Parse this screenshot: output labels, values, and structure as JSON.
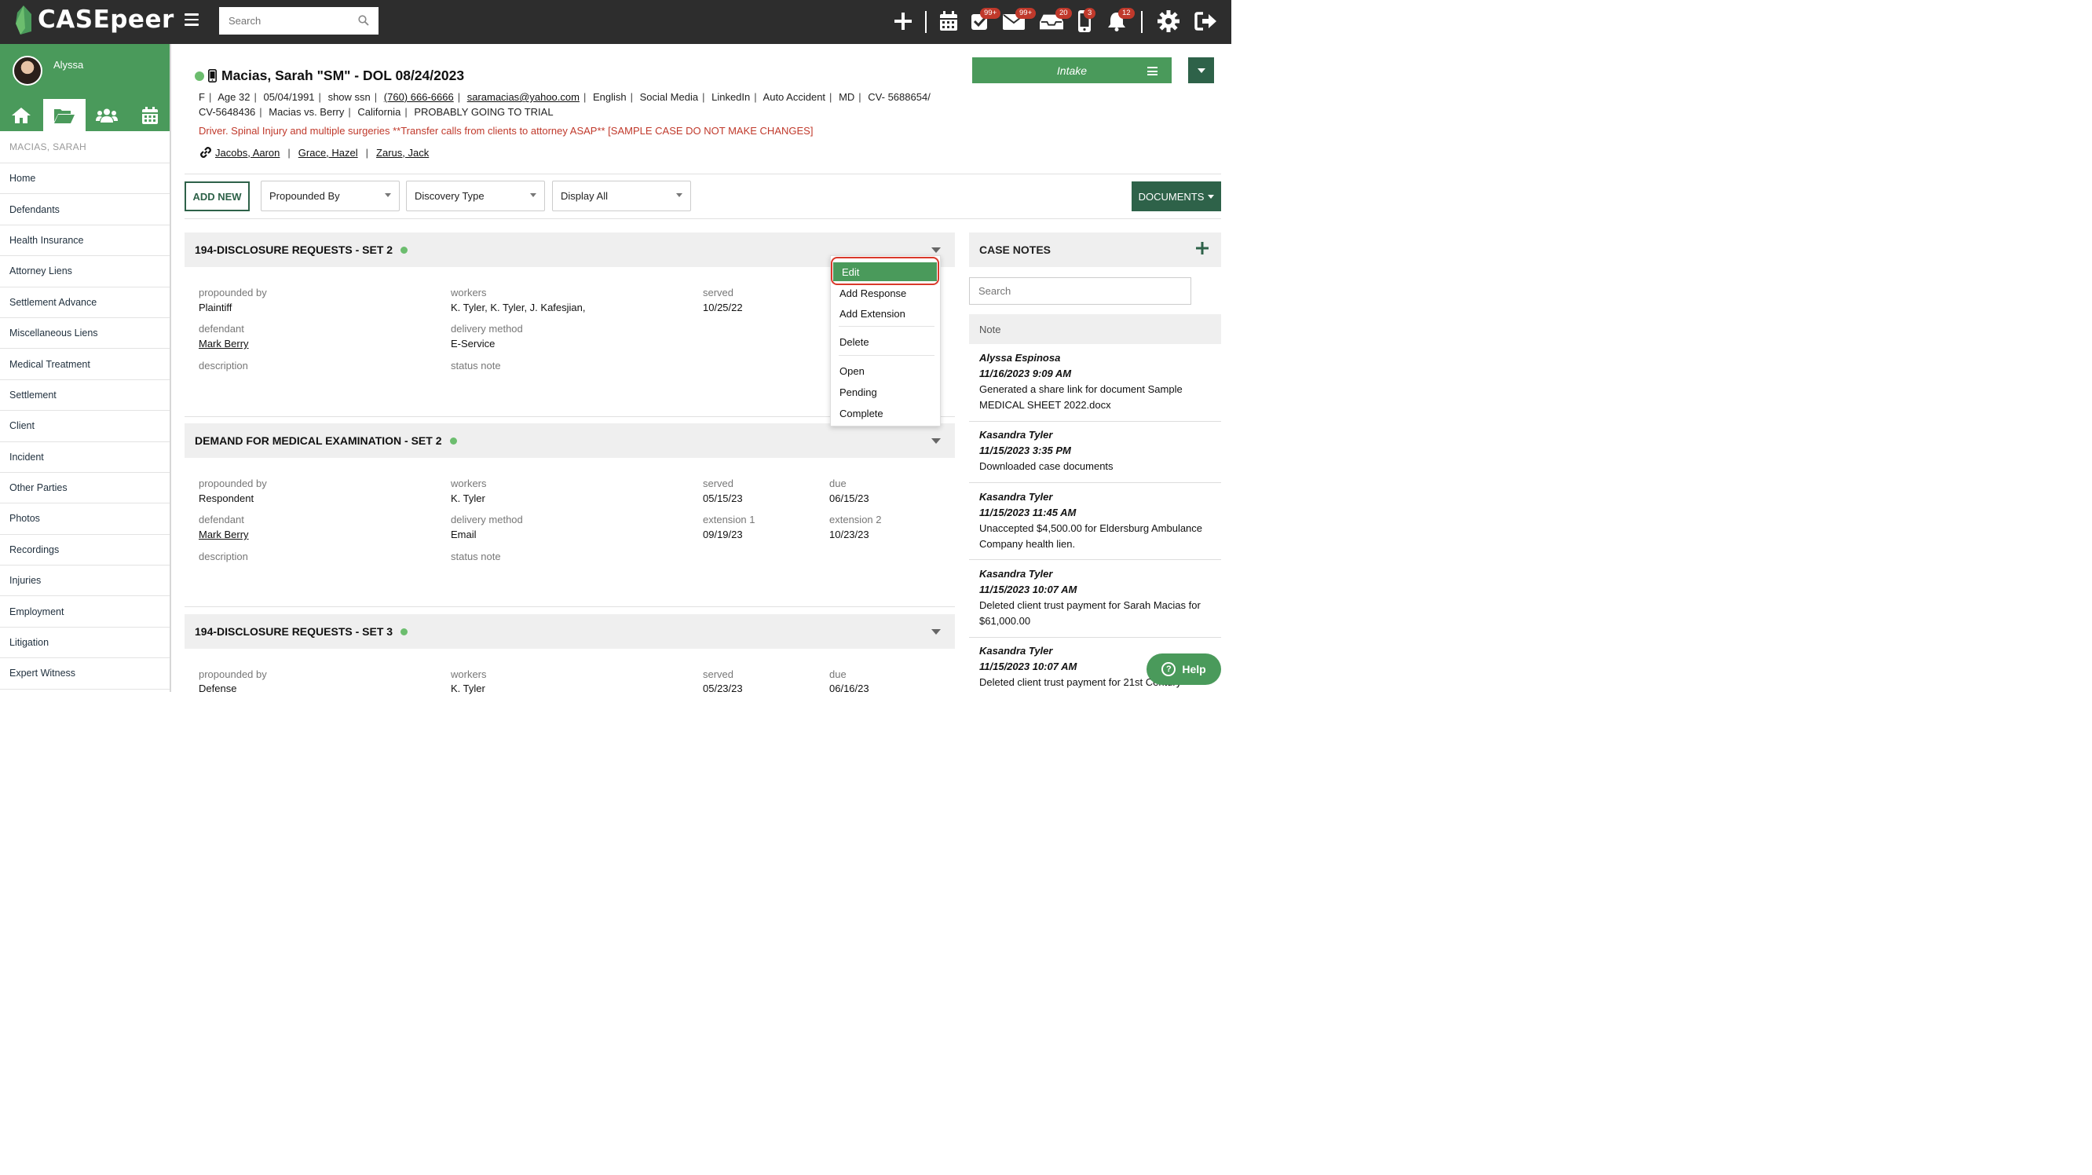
{
  "brand": {
    "name": "CASEpeer"
  },
  "topbar": {
    "search_placeholder": "Search",
    "badges": {
      "tasks": "99+",
      "mail": "99+",
      "inbox": "20",
      "phone": "3",
      "bell": "12"
    }
  },
  "sidebar": {
    "username": "Alyssa",
    "caption": "MACIAS, SARAH",
    "items": [
      "Home",
      "Defendants",
      "Health Insurance",
      "Attorney Liens",
      "Settlement Advance",
      "Miscellaneous Liens",
      "Medical Treatment",
      "Settlement",
      "Client",
      "Incident",
      "Other Parties",
      "Photos",
      "Recordings",
      "Injuries",
      "Employment",
      "Litigation",
      "Expert Witness"
    ]
  },
  "case": {
    "title": "Macias, Sarah \"SM\" - DOL 08/24/2023",
    "meta1": {
      "sex": "F",
      "age": "Age 32",
      "dob": "05/04/1991",
      "ssn": "show ssn",
      "phone": "(760) 666-6666",
      "email": "saramacias@yahoo.com",
      "language": "English",
      "source": "Social Media",
      "sub_source": "LinkedIn",
      "case_type": "Auto Accident",
      "state": "MD",
      "case_no": "CV- 5688654/"
    },
    "meta2": {
      "case_no2": "CV-5648436",
      "caption": "Macias vs. Berry",
      "venue": "California",
      "status": "PROBABLY GOING TO TRIAL"
    },
    "alert": "Driver. Spinal Injury and multiple surgeries **Transfer calls from clients to attorney ASAP** [SAMPLE CASE DO NOT MAKE CHANGES]",
    "linked": [
      "Jacobs, Aaron",
      "Grace, Hazel",
      "Zarus, Jack"
    ]
  },
  "intake": {
    "label": "Intake"
  },
  "toolbar": {
    "add_new": "ADD NEW",
    "filter_propounded": "Propounded By",
    "filter_type": "Discovery Type",
    "filter_display": "Display All",
    "documents": "DOCUMENTS"
  },
  "labels": {
    "propounded_by": "propounded by",
    "workers": "workers",
    "served": "served",
    "due": "due",
    "defendant": "defendant",
    "delivery_method": "delivery method",
    "extension1": "extension 1",
    "extension2": "extension 2",
    "description": "description",
    "status_note": "status note"
  },
  "sections": [
    {
      "title": "194-DISCLOSURE REQUESTS - SET 2",
      "propounded_by": "Plaintiff",
      "workers": "K. Tyler, K. Tyler, J. Kafesjian,",
      "served": "10/25/22",
      "defendant": "Mark Berry",
      "delivery_method": "E-Service"
    },
    {
      "title": "DEMAND FOR MEDICAL EXAMINATION - SET 2",
      "propounded_by": "Respondent",
      "workers": "K. Tyler",
      "served": "05/15/23",
      "due": "06/15/23",
      "defendant": "Mark Berry",
      "delivery_method": "Email",
      "extension1": "09/19/23",
      "extension2": "10/23/23"
    },
    {
      "title": "194-DISCLOSURE REQUESTS - SET 3",
      "propounded_by": "Defense",
      "workers": "K. Tyler",
      "served": "05/23/23",
      "due": "06/16/23"
    }
  ],
  "menu": {
    "items": [
      "Edit",
      "Add Response",
      "Add Extension",
      "Delete",
      "Open",
      "Pending",
      "Complete"
    ]
  },
  "notes": {
    "title": "CASE NOTES",
    "search_placeholder": "Search",
    "column": "Note",
    "items": [
      {
        "author": "Alyssa Espinosa",
        "date": "11/16/2023 9:09 AM",
        "text": "Generated a share link for document Sample MEDICAL SHEET 2022.docx"
      },
      {
        "author": "Kasandra Tyler",
        "date": "11/15/2023 3:35 PM",
        "text": "Downloaded case documents"
      },
      {
        "author": "Kasandra Tyler",
        "date": "11/15/2023 11:45 AM",
        "text": "Unaccepted $4,500.00 for Eldersburg Ambulance Company health lien."
      },
      {
        "author": "Kasandra Tyler",
        "date": "11/15/2023 10:07 AM",
        "text": "Deleted client trust payment for Sarah Macias for $61,000.00"
      },
      {
        "author": "Kasandra Tyler",
        "date": "11/15/2023 10:07 AM",
        "text": "Deleted client trust payment for 21st Century"
      }
    ]
  },
  "help": {
    "label": "Help"
  }
}
